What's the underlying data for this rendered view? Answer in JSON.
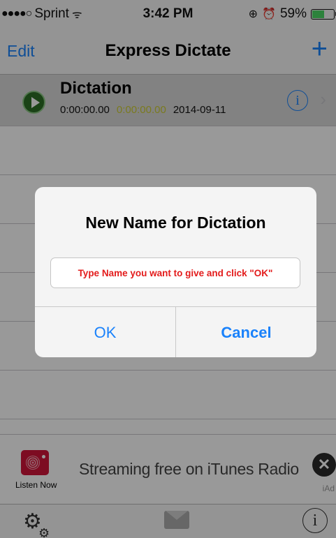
{
  "status_bar": {
    "signal": "●●●●○",
    "carrier": "Sprint",
    "wifi": "ᯤ",
    "time": "3:42 PM",
    "battery": "59%",
    "battery_level": 0.59
  },
  "nav": {
    "edit_label": "Edit",
    "title": "Express Dictate",
    "add_label": "+"
  },
  "list": {
    "rows": [
      {
        "name": "Dictation",
        "duration": "0:00:00.00",
        "position": "0:00:00.00",
        "date": "2014-09-11",
        "info": "i",
        "chevron": "›"
      }
    ]
  },
  "ad": {
    "listen_label": "Listen Now",
    "text": "Streaming free on iTunes Radio",
    "close": "✕",
    "iad": "iAd"
  },
  "toolbar": {
    "settings_icon": "gear-icon",
    "mail_icon": "mail-forward-icon",
    "info": "i"
  },
  "alert": {
    "title": "New Name for Dictation",
    "placeholder": "Type Name you want to give and click \"OK\"",
    "ok_label": "OK",
    "cancel_label": "Cancel"
  },
  "colors": {
    "accent": "#1a82fb",
    "placeholder": "#e31b1b",
    "play_green": "#2c6e25",
    "position_yellow": "#cccc33"
  }
}
